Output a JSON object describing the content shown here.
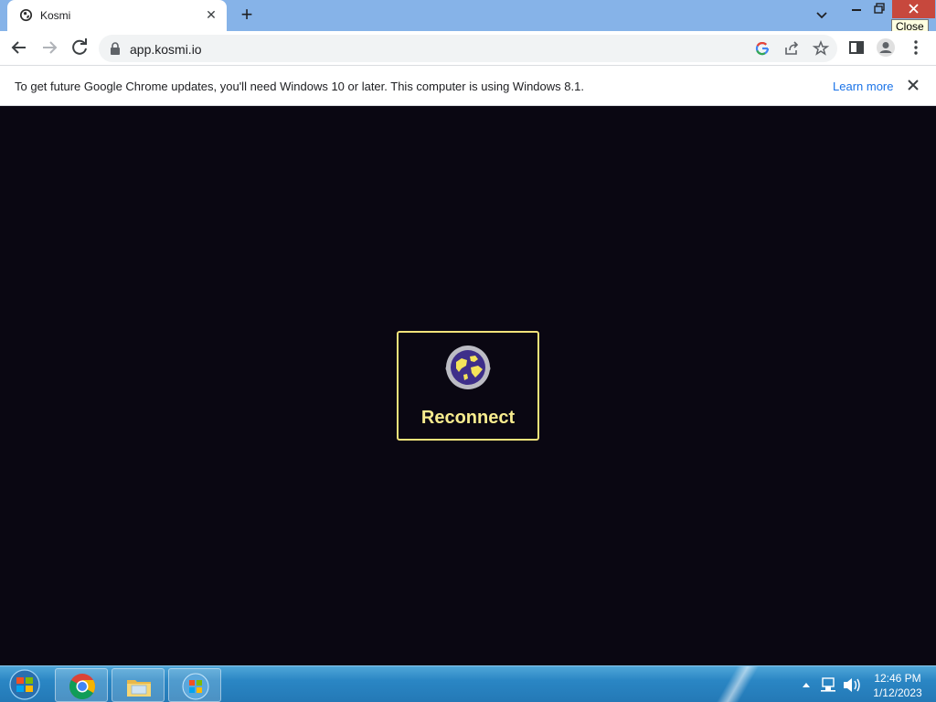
{
  "browser": {
    "tab": {
      "title": "Kosmi",
      "favicon": "kosmi-globe-icon"
    },
    "window": {
      "close_tooltip": "Close"
    },
    "address_bar": {
      "url": "app.kosmi.io"
    }
  },
  "infobar": {
    "message": "To get future Google Chrome updates, you'll need Windows 10 or later. This computer is using Windows 8.1.",
    "link": "Learn more"
  },
  "page": {
    "reconnect_label": "Reconnect"
  },
  "taskbar": {
    "apps": [
      "chrome",
      "file-explorer",
      "windows-globe"
    ],
    "clock_time": "12:46 PM",
    "clock_date": "1/12/2023"
  },
  "colors": {
    "page_background": "#0a0712",
    "accent_yellow": "#f3e27a",
    "tabstrip": "#86b3e8",
    "close_red": "#c7483d",
    "link_blue": "#1a73e8"
  }
}
